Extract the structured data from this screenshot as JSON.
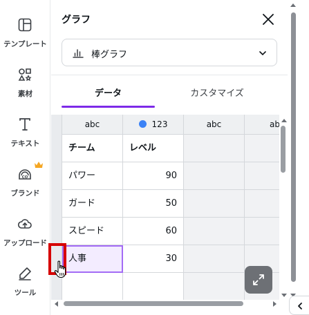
{
  "sidebar": {
    "items": [
      {
        "label": "テンプレート",
        "icon": "template-icon"
      },
      {
        "label": "素材",
        "icon": "elements-icon"
      },
      {
        "label": "テキスト",
        "icon": "text-icon"
      },
      {
        "label": "ブランド",
        "icon": "brand-icon"
      },
      {
        "label": "アップロード",
        "icon": "upload-icon"
      },
      {
        "label": "ツール",
        "icon": "tools-icon"
      }
    ],
    "crown_color": "#f5a623"
  },
  "panel": {
    "title": "グラフ",
    "chart_type_select": {
      "value": "棒グラフ",
      "icon": "bar-chart-icon"
    },
    "tabs": [
      {
        "label": "データ",
        "active": true
      },
      {
        "label": "カスタマイズ",
        "active": false
      }
    ]
  },
  "table": {
    "column_types": [
      "abc",
      "123",
      "abc",
      "ab"
    ],
    "header_row": [
      "チーム",
      "レベル"
    ],
    "rows": [
      {
        "name": "パワー",
        "value": "90"
      },
      {
        "name": "ガード",
        "value": "50"
      },
      {
        "name": "スピード",
        "value": "60"
      },
      {
        "name": "人事",
        "value": "30"
      },
      {
        "name": "",
        "value": ""
      }
    ]
  },
  "colors": {
    "accent": "#7d2ae8",
    "series_dot": "#3b82f6",
    "annotation": "#d60000"
  }
}
